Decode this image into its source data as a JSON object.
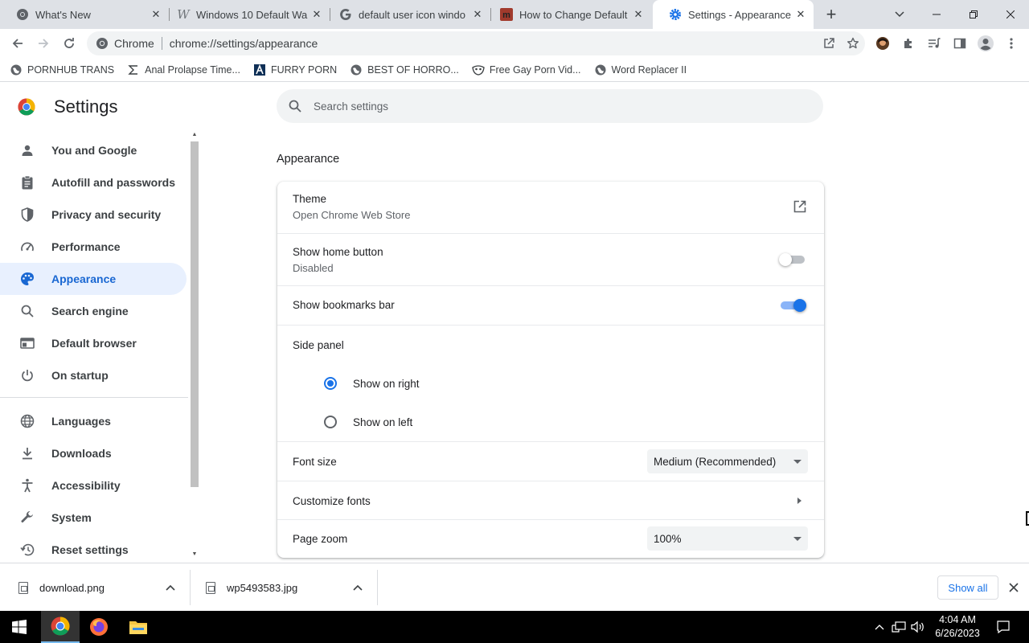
{
  "tabs": [
    {
      "title": "What's New",
      "icon": "chrome-icon",
      "active": false
    },
    {
      "title": "Windows 10 Default Wa",
      "icon": "wikimedia-icon",
      "active": false
    },
    {
      "title": "default user icon windo",
      "icon": "google-icon",
      "active": false
    },
    {
      "title": "How to Change Default",
      "icon": "makeuseof-icon",
      "active": false
    },
    {
      "title": "Settings - Appearance",
      "icon": "settings-gear-icon",
      "active": true
    }
  ],
  "toolbar": {
    "chip_label": "Chrome",
    "url": "chrome://settings/appearance"
  },
  "bookmarks": [
    {
      "label": "PORNHUB TRANS",
      "icon": "globe-icon"
    },
    {
      "label": "Anal Prolapse Time...",
      "icon": "sigma-icon"
    },
    {
      "label": "FURRY PORN",
      "icon": "a-logo-icon"
    },
    {
      "label": "BEST OF HORRO...",
      "icon": "globe-icon"
    },
    {
      "label": "Free Gay Porn Vid...",
      "icon": "mask-icon"
    },
    {
      "label": "Word Replacer II",
      "icon": "globe-icon"
    }
  ],
  "settings": {
    "title": "Settings",
    "search_placeholder": "Search settings",
    "nav": [
      {
        "label": "You and Google",
        "icon": "person-icon"
      },
      {
        "label": "Autofill and passwords",
        "icon": "clipboard-icon"
      },
      {
        "label": "Privacy and security",
        "icon": "shield-icon"
      },
      {
        "label": "Performance",
        "icon": "speedometer-icon"
      },
      {
        "label": "Appearance",
        "icon": "palette-icon"
      },
      {
        "label": "Search engine",
        "icon": "search-icon"
      },
      {
        "label": "Default browser",
        "icon": "browser-window-icon"
      },
      {
        "label": "On startup",
        "icon": "power-icon"
      },
      {
        "label": "Languages",
        "icon": "globe-icon"
      },
      {
        "label": "Downloads",
        "icon": "download-icon"
      },
      {
        "label": "Accessibility",
        "icon": "accessibility-icon"
      },
      {
        "label": "System",
        "icon": "wrench-icon"
      },
      {
        "label": "Reset settings",
        "icon": "history-icon"
      }
    ],
    "selected_nav": "Appearance",
    "section_title": "Appearance",
    "theme": {
      "label": "Theme",
      "sub": "Open Chrome Web Store"
    },
    "home_button": {
      "label": "Show home button",
      "sub": "Disabled",
      "enabled": false
    },
    "bookmarks_bar": {
      "label": "Show bookmarks bar",
      "enabled": true
    },
    "side_panel": {
      "label": "Side panel",
      "options": [
        "Show on right",
        "Show on left"
      ],
      "selected": "Show on right"
    },
    "font_size": {
      "label": "Font size",
      "value": "Medium (Recommended)"
    },
    "customize_fonts": {
      "label": "Customize fonts"
    },
    "page_zoom": {
      "label": "Page zoom",
      "value": "100%"
    }
  },
  "downloads": [
    {
      "name": "download.png"
    },
    {
      "name": "wp5493583.jpg"
    }
  ],
  "downloads_show_all": "Show all",
  "taskbar": {
    "time": "4:04 AM",
    "date": "6/26/2023"
  },
  "colors": {
    "accent": "#1a73e8",
    "nav_selected_bg": "#e8f0fe",
    "nav_selected_text": "#1967d2"
  }
}
